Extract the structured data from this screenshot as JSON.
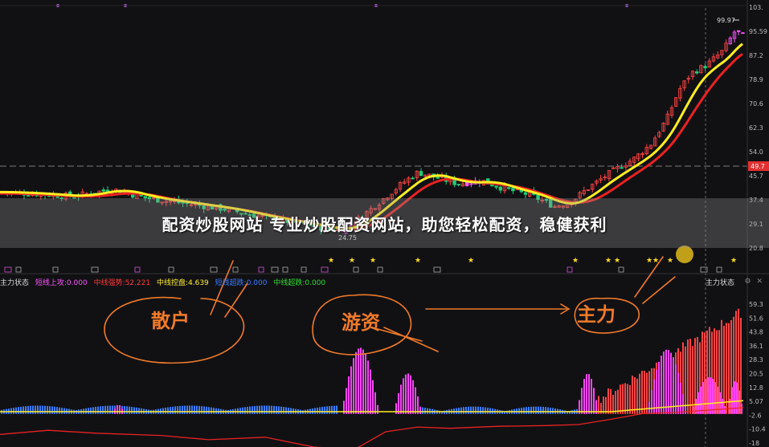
{
  "chart_data": [
    {
      "type": "candlestick",
      "title": "",
      "y_ticks": [
        "103.",
        "95.59",
        "87.2",
        "78.9",
        "70.6",
        "62.3",
        "54.0",
        "45.7",
        "37.4",
        "29.1",
        "20.8"
      ],
      "price_labels": {
        "high": "99.97",
        "low": "24.75",
        "current": "49.7"
      },
      "ylim": [
        18,
        105
      ],
      "markers": "★"
    },
    {
      "type": "bar",
      "title": "主力状态",
      "y_ticks": [
        "59.3",
        "51.6",
        "43.8",
        "36.1",
        "28.3",
        "20.5",
        "12.8",
        "5.07",
        "-2.6",
        "-10.4",
        "-18"
      ],
      "ylim": [
        -18,
        68
      ]
    }
  ],
  "indicator": {
    "title": "主力状态",
    "items": [
      {
        "label": "短线上攻:0.000",
        "color": "#ff55ff"
      },
      {
        "label": "中线强势:52.221",
        "color": "#ff3a3a"
      },
      {
        "label": "中线控盘:4.639",
        "color": "#ffee33"
      },
      {
        "label": "短线超跌:0.000",
        "color": "#3a7bff"
      },
      {
        "label": "中线超跌:0.000",
        "color": "#33dd33"
      }
    ]
  },
  "right_title": "主力状态",
  "banner": "配资炒股网站 专业炒股配资网站，助您轻松配资，稳健获利",
  "annotations": {
    "retail": "散户",
    "hot_money": "游资",
    "main_force": "主力"
  },
  "colors": {
    "background": "#111114",
    "up": "#ff4444",
    "down": "#22cc77",
    "ma_yellow": "#ffee22",
    "ma_red": "#ee2222",
    "annotation": "#f07a2a",
    "magenta": "#ff44ff",
    "blue": "#3a7bff"
  }
}
